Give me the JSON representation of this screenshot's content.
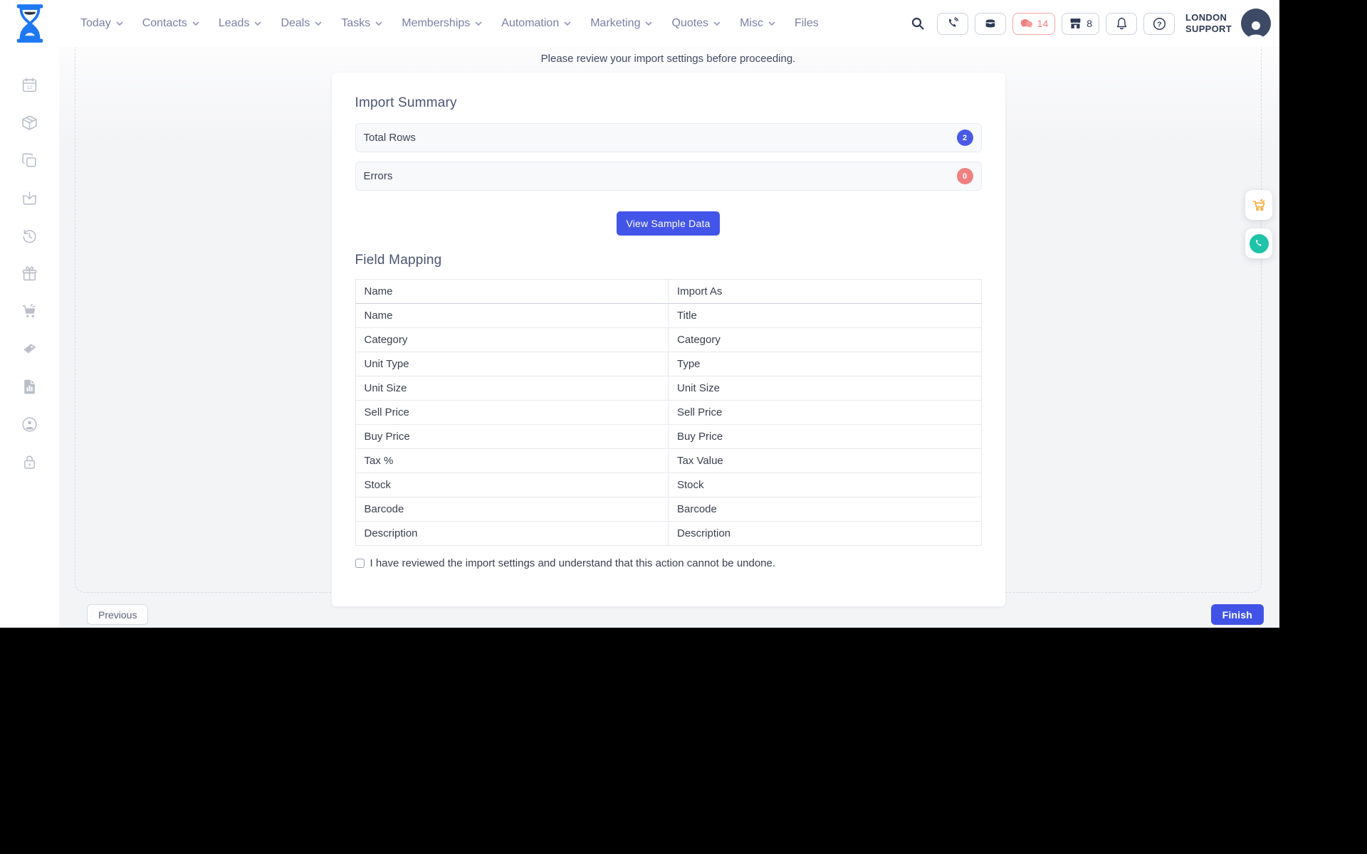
{
  "header": {
    "nav": [
      {
        "label": "Today",
        "chevron": true
      },
      {
        "label": "Contacts",
        "chevron": true
      },
      {
        "label": "Leads",
        "chevron": true
      },
      {
        "label": "Deals",
        "chevron": true
      },
      {
        "label": "Tasks",
        "chevron": true
      },
      {
        "label": "Memberships",
        "chevron": true
      },
      {
        "label": "Automation",
        "chevron": true
      },
      {
        "label": "Marketing",
        "chevron": true
      },
      {
        "label": "Quotes",
        "chevron": true
      },
      {
        "label": "Misc",
        "chevron": true
      },
      {
        "label": "Files",
        "chevron": false
      }
    ],
    "chat_count": "14",
    "store_count": "8",
    "profile": {
      "line1": "LONDON",
      "line2": "SUPPORT"
    },
    "icons": [
      "search-icon",
      "phone-icon",
      "inbox-icon",
      "chat-icon",
      "store-icon",
      "bell-icon",
      "help-icon",
      "avatar"
    ]
  },
  "sidebar": {
    "icons": [
      "calendar-12-icon",
      "package-icon",
      "copy-icon",
      "basket-in-icon",
      "history-icon",
      "gift-icon",
      "cart-icon",
      "coupon-icon",
      "report-icon",
      "account-icon",
      "lock-icon"
    ]
  },
  "wizard": {
    "notice": "Please review your import settings before proceeding.",
    "import_summary": {
      "title": "Import Summary",
      "rows": [
        {
          "label": "Total Rows",
          "value": "2",
          "color": "#4a5ae6"
        },
        {
          "label": "Errors",
          "value": "0",
          "color": "#ef8080"
        }
      ]
    },
    "view_sample_label": "View Sample Data",
    "field_mapping": {
      "title": "Field Mapping",
      "columns": [
        "Name",
        "Import As"
      ],
      "rows": [
        {
          "source": "Name",
          "target": "Title"
        },
        {
          "source": "Category",
          "target": "Category"
        },
        {
          "source": "Unit Type",
          "target": "Type"
        },
        {
          "source": "Unit Size",
          "target": "Unit Size"
        },
        {
          "source": "Sell Price",
          "target": "Sell Price"
        },
        {
          "source": "Buy Price",
          "target": "Buy Price"
        },
        {
          "source": "Tax %",
          "target": "Tax Value"
        },
        {
          "source": "Stock",
          "target": "Stock"
        },
        {
          "source": "Barcode",
          "target": "Barcode"
        },
        {
          "source": "Description",
          "target": "Description"
        }
      ]
    },
    "confirm_label": "I have reviewed the import settings and understand that this action cannot be undone."
  },
  "footer": {
    "previous_label": "Previous",
    "finish_label": "Finish"
  },
  "colors": {
    "accent_blue": "#4355e8",
    "badge_blue": "#4a5ae6",
    "badge_red": "#ef8080",
    "alert_salmon": "#f0807f",
    "navy_icon": "#2e3a55",
    "nav_text": "#7b80a3",
    "page_bg": "#f3f4f6",
    "cart_orange": "#f5a731",
    "phone_teal": "#1fc3a7"
  }
}
